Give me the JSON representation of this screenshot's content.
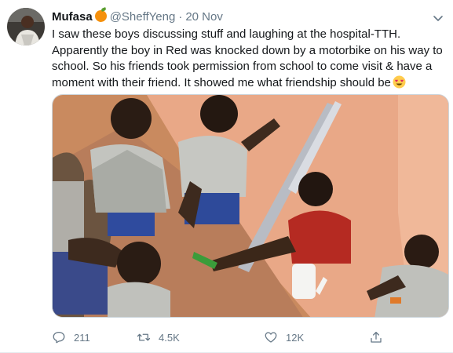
{
  "user": {
    "display_name": "Mufasa",
    "name_emoji": "orange-emoji",
    "handle": "@SheffYeng",
    "separator": "·",
    "date": "20 Nov"
  },
  "tweet": {
    "text": "I saw these boys discussing stuff and laughing at the hospital-TTH. Apparently the boy in Red was knocked down by a motorbike on his way to school. So his friends took permission from school to come visit & have a moment with their friend. It showed me what friendship should be",
    "trailing_emoji": "heart-eyes-emoji"
  },
  "actions": {
    "reply_count": "211",
    "retweet_count": "4.5K",
    "like_count": "12K"
  },
  "colors": {
    "secondary_text": "#657786",
    "primary_text": "#14171a",
    "divider": "#e6ecf0"
  }
}
